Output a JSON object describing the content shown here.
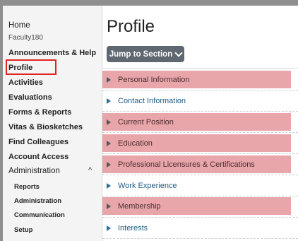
{
  "sidebar": {
    "home": "Home",
    "org": "Faculty180",
    "items": [
      {
        "label": "Announcements & Help"
      },
      {
        "label": "Profile"
      },
      {
        "label": "Activities"
      },
      {
        "label": "Evaluations"
      },
      {
        "label": "Forms & Reports"
      },
      {
        "label": "Vitas & Biosketches"
      },
      {
        "label": "Find Colleagues"
      },
      {
        "label": "Account Access"
      }
    ],
    "admin_label": "Administration",
    "admin_sub": [
      "Reports",
      "Administration",
      "Communication",
      "Setup"
    ]
  },
  "main": {
    "title": "Profile",
    "jump_button": "Jump to Section",
    "sections": [
      {
        "label": "Personal Information",
        "highlighted": true
      },
      {
        "label": "Contact Information",
        "highlighted": false
      },
      {
        "label": "Current Position",
        "highlighted": true
      },
      {
        "label": "Education",
        "highlighted": true
      },
      {
        "label": "Professional Licensures & Certifications",
        "highlighted": true
      },
      {
        "label": "Work Experience",
        "highlighted": false
      },
      {
        "label": "Membership",
        "highlighted": true
      },
      {
        "label": "Interests",
        "highlighted": false
      }
    ]
  },
  "colors": {
    "highlight": "#e8a6ab",
    "accent": "#e0231f",
    "link": "#1e5b86",
    "button": "#5f6770"
  },
  "icons": {
    "section": "play-triangle-icon",
    "dropdown": "chevron-down-icon",
    "collapse": "chevron-up-icon"
  }
}
